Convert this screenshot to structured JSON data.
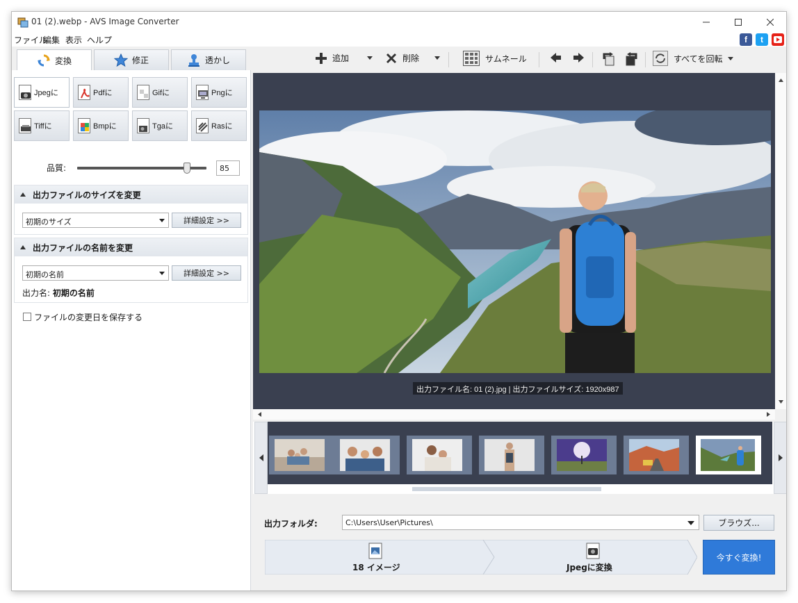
{
  "window": {
    "title": "01 (2).webp - AVS Image Converter"
  },
  "menu": [
    "ファイル",
    "編集",
    "表示",
    "ヘルプ"
  ],
  "social": {
    "facebook": "f",
    "twitter": "t"
  },
  "tabs": [
    {
      "label": "変換",
      "icon": "convert-icon"
    },
    {
      "label": "修正",
      "icon": "star-icon"
    },
    {
      "label": "透かし",
      "icon": "stamp-icon"
    }
  ],
  "formats": [
    {
      "label": "Jpegに",
      "active": true
    },
    {
      "label": "Pdfに"
    },
    {
      "label": "Gifに"
    },
    {
      "label": "Pngに"
    },
    {
      "label": "Tiffに"
    },
    {
      "label": "Bmpに"
    },
    {
      "label": "Tgaに"
    },
    {
      "label": "Rasに"
    }
  ],
  "quality": {
    "label": "品質:",
    "value": "85",
    "level": 85
  },
  "resize": {
    "heading": "出力ファイルのサイズを変更",
    "selected": "初期のサイズ",
    "advanced": "詳細設定 >>"
  },
  "rename": {
    "heading": "出力ファイルの名前を変更",
    "selected": "初期の名前",
    "advanced": "詳細設定 >>",
    "output_name_label": "出力名:",
    "output_name_value": "初期の名前"
  },
  "keep_date": {
    "label": "ファイルの変更日を保存する",
    "checked": false
  },
  "toolbar": {
    "add": "追加",
    "delete": "削除",
    "thumbnail": "サムネール",
    "rotate_all": "すべてを回転"
  },
  "preview": {
    "caption": "出力ファイル名: 01 (2).jpg | 出力ファイルサイズ: 1920x987"
  },
  "output": {
    "label": "出力フォルダ:",
    "path": "C:\\Users\\User\\Pictures\\",
    "browse": "ブラウズ..."
  },
  "steps": {
    "count": "18 イメージ",
    "target": "Jpegに変換"
  },
  "convert_button": "今すぐ変換!",
  "colors": {
    "accent": "#2f7ad9",
    "preview_bg": "#3a4050",
    "thumb_border": "#6d7c95"
  }
}
